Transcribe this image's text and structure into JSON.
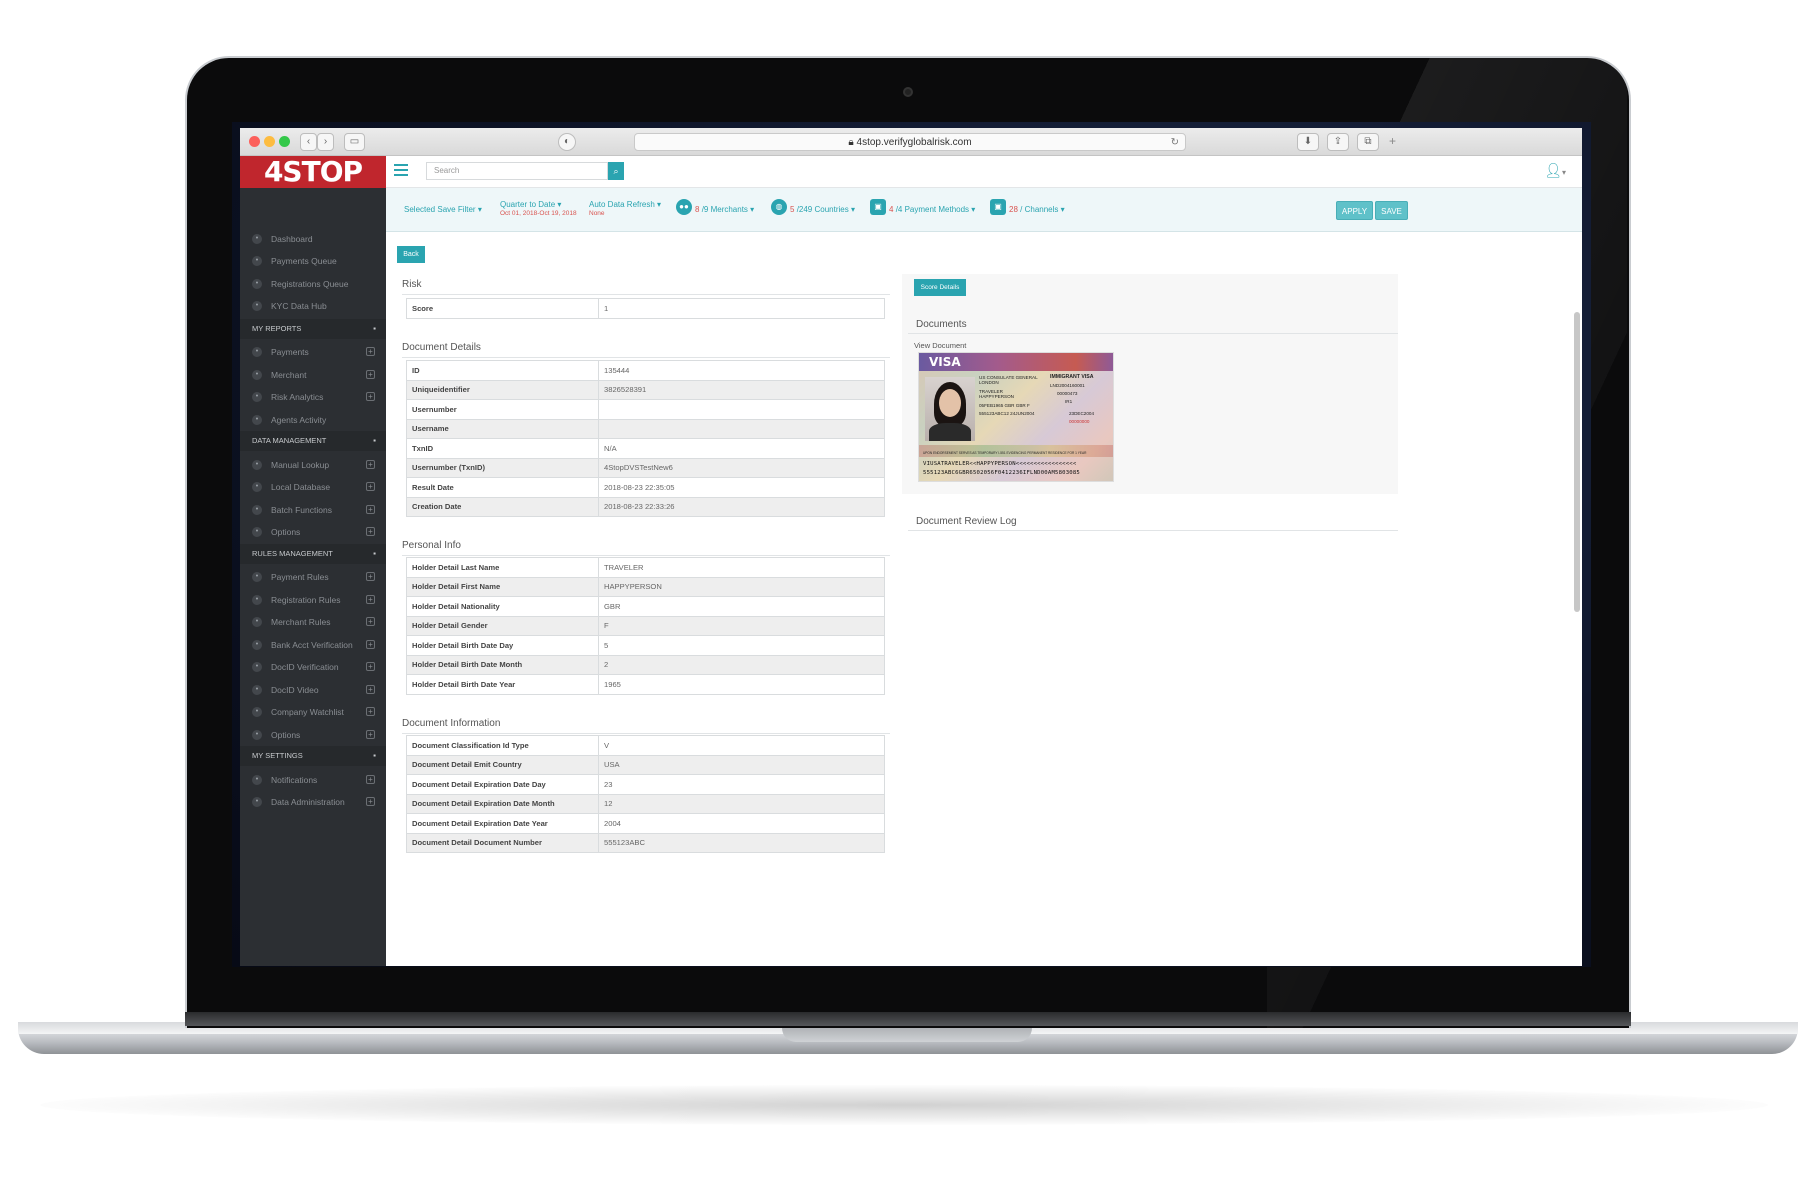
{
  "browser": {
    "url": "4stop.verifyglobalrisk.com"
  },
  "app": {
    "logo": "4STOP",
    "search_placeholder": "Search"
  },
  "sidebar": {
    "items_top": [
      {
        "label": "Dashboard",
        "icon": "dashboard-icon"
      },
      {
        "label": "Payments Queue",
        "icon": "bolt-icon"
      },
      {
        "label": "Registrations Queue",
        "icon": "users-icon"
      },
      {
        "label": "KYC Data Hub",
        "icon": "network-icon"
      }
    ],
    "sections": [
      {
        "title": "MY REPORTS",
        "icon": "bar-chart-icon",
        "items": [
          {
            "label": "Payments"
          },
          {
            "label": "Merchant"
          },
          {
            "label": "Risk Analytics"
          },
          {
            "label": "Agents Activity",
            "no_plus": true
          }
        ]
      },
      {
        "title": "DATA MANAGEMENT",
        "icon": "grid-icon",
        "items": [
          {
            "label": "Manual Lookup"
          },
          {
            "label": "Local Database"
          },
          {
            "label": "Batch Functions"
          },
          {
            "label": "Options"
          }
        ]
      },
      {
        "title": "RULES MANAGEMENT",
        "icon": "shield-icon",
        "items": [
          {
            "label": "Payment Rules"
          },
          {
            "label": "Registration Rules"
          },
          {
            "label": "Merchant Rules"
          },
          {
            "label": "Bank Acct Verification"
          },
          {
            "label": "DocID Verification"
          },
          {
            "label": "DocID Video"
          },
          {
            "label": "Company Watchlist"
          },
          {
            "label": "Options"
          }
        ]
      },
      {
        "title": "MY SETTINGS",
        "icon": "gears-icon",
        "items": [
          {
            "label": "Notifications"
          },
          {
            "label": "Data Administration"
          }
        ]
      }
    ]
  },
  "filters": {
    "saved_filter": "Selected Save Filter",
    "period_label": "Quarter to Date",
    "period_range": "Oct 01, 2018-Oct 19, 2018",
    "refresh_label": "Auto Data Refresh",
    "refresh_value": "None",
    "merchants_count": "8",
    "merchants_total": "/9 Merchants",
    "countries_count": "5",
    "countries_total": "/249 Countries",
    "payment_count": "4",
    "payment_total": "/4 Payment Methods",
    "channels_count": "28",
    "channels_total": "/ Channels",
    "apply": "APPLY",
    "save": "SAVE"
  },
  "content": {
    "back": "Back",
    "risk": {
      "title": "Risk",
      "rows": [
        {
          "k": "Score",
          "v": "1"
        }
      ]
    },
    "document_details": {
      "title": "Document Details",
      "rows": [
        {
          "k": "ID",
          "v": "135444"
        },
        {
          "k": "Uniqueidentifier",
          "v": "3826528391"
        },
        {
          "k": "Usernumber",
          "v": ""
        },
        {
          "k": "Username",
          "v": ""
        },
        {
          "k": "TxnID",
          "v": "N/A"
        },
        {
          "k": "Usernumber (TxnID)",
          "v": "4StopDVSTestNew6"
        },
        {
          "k": "Result Date",
          "v": "2018-08-23 22:35:05"
        },
        {
          "k": "Creation Date",
          "v": "2018-08-23 22:33:26"
        }
      ]
    },
    "personal_info": {
      "title": "Personal Info",
      "rows": [
        {
          "k": "Holder Detail Last Name",
          "v": "TRAVELER"
        },
        {
          "k": "Holder Detail First Name",
          "v": "HAPPYPERSON"
        },
        {
          "k": "Holder Detail Nationality",
          "v": "GBR"
        },
        {
          "k": "Holder Detail Gender",
          "v": "F"
        },
        {
          "k": "Holder Detail Birth Date Day",
          "v": "5"
        },
        {
          "k": "Holder Detail Birth Date Month",
          "v": "2"
        },
        {
          "k": "Holder Detail Birth Date Year",
          "v": "1965"
        }
      ]
    },
    "document_information": {
      "title": "Document Information",
      "rows": [
        {
          "k": "Document Classification Id Type",
          "v": "V"
        },
        {
          "k": "Document Detail Emit Country",
          "v": "USA"
        },
        {
          "k": "Document Detail Expiration Date Day",
          "v": "23"
        },
        {
          "k": "Document Detail Expiration Date Month",
          "v": "12"
        },
        {
          "k": "Document Detail Expiration Date Year",
          "v": "2004"
        },
        {
          "k": "Document Detail Document Number",
          "v": "555123ABC"
        }
      ]
    },
    "score_details": "Score Details",
    "documents_title": "Documents",
    "view_document": "View Document",
    "review_log_title": "Document Review Log"
  },
  "visa_image": {
    "word": "VISA",
    "type_line": "IMMIGRANT VISA",
    "post": "US CONSULATE GENERAL",
    "city": "LONDON",
    "surname": "TRAVELER",
    "given": "HAPPYPERSON",
    "case_number": "LND2004160001",
    "number": "00000473",
    "category": "IR1",
    "birth_date": "05FEB1965",
    "birthplace": "GBR",
    "nationality": "GBR",
    "sex": "F",
    "passport": "555123ABC12",
    "issue_date": "24JUN2004",
    "expiration": "23DEC2004",
    "control": "00000000",
    "annotation": "UPON ENDORSEMENT SERVES AS TEMPORARY I-551 EVIDENCING PERMANENT RESIDENCE FOR 1 YEAR",
    "mrz1": "VIUSATRAVELER<<HAPPYPERSON<<<<<<<<<<<<<<<<<",
    "mrz2": "555123ABC6GBR6502056F0412236IFLND00AM5803085"
  }
}
